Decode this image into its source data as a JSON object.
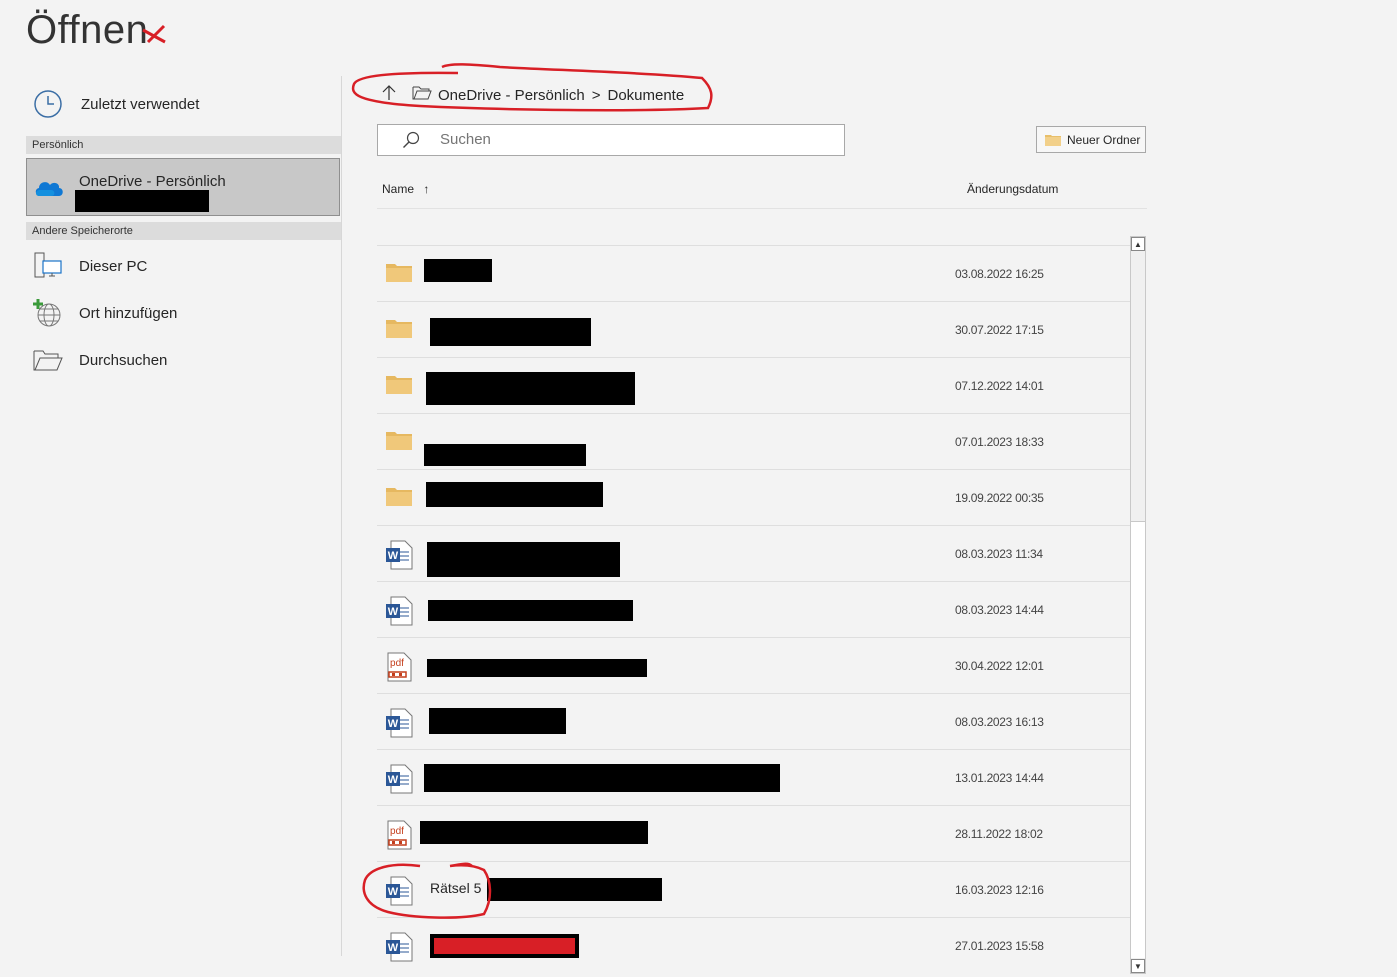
{
  "window": {
    "title": "Öffnen"
  },
  "sidebar": {
    "recent_label": "Zuletzt verwendet",
    "section_personal": "Persönlich",
    "onedrive_label": "OneDrive - Persönlich",
    "section_other": "Andere Speicherorte",
    "this_pc_label": "Dieser PC",
    "add_place_label": "Ort hinzufügen",
    "browse_label": "Durchsuchen"
  },
  "breadcrumb": {
    "root": "OneDrive - Persönlich",
    "separator": ">",
    "current": "Dokumente"
  },
  "search": {
    "placeholder": "Suchen"
  },
  "toolbar": {
    "new_folder_label": "Neuer Ordner"
  },
  "columns": {
    "name": "Name",
    "sort_indicator": "↑",
    "date": "Änderungsdatum"
  },
  "files": [
    {
      "type": "folder",
      "name": "",
      "date": "03.08.2022 16:25"
    },
    {
      "type": "folder",
      "name": "",
      "date": "30.07.2022 17:15"
    },
    {
      "type": "folder",
      "name": "",
      "date": "07.12.2022 14:01"
    },
    {
      "type": "folder",
      "name": "",
      "date": "07.01.2023 18:33"
    },
    {
      "type": "folder",
      "name": "",
      "date": "19.09.2022 00:35"
    },
    {
      "type": "word",
      "name": "",
      "date": "08.03.2023 11:34"
    },
    {
      "type": "word",
      "name": "",
      "date": "08.03.2023 14:44"
    },
    {
      "type": "pdf",
      "name": "",
      "date": "30.04.2022 12:01"
    },
    {
      "type": "word",
      "name": "",
      "date": "08.03.2023 16:13"
    },
    {
      "type": "word",
      "name": "",
      "date": "13.01.2023 14:44"
    },
    {
      "type": "pdf",
      "name": "",
      "date": "28.11.2022 18:02"
    },
    {
      "type": "word",
      "name": "Rätsel 5",
      "date": "16.03.2023 12:16"
    },
    {
      "type": "word",
      "name": "",
      "date": "27.01.2023 15:58"
    }
  ],
  "icons": {
    "word_letter": "W",
    "pdf_text": "pdf"
  },
  "colors": {
    "annotation_red": "#d81f26",
    "folder_yellow": "#f0c87a",
    "word_blue": "#2b5797",
    "pdf_red": "#c43e1c",
    "onedrive_blue": "#0f78d4"
  }
}
